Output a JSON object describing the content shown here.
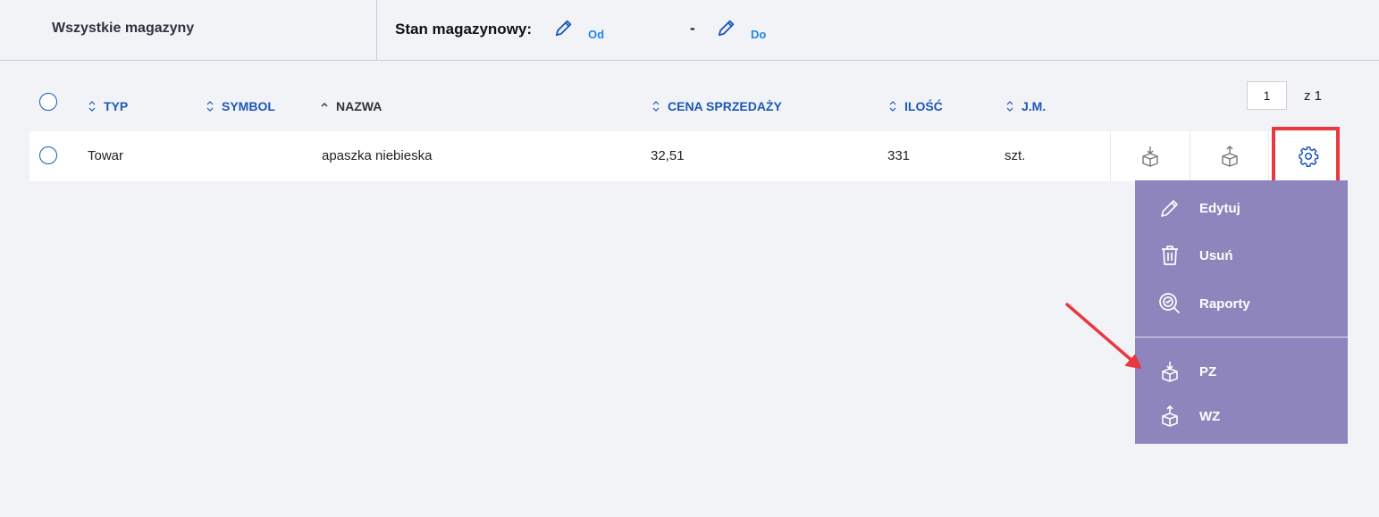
{
  "filters": {
    "warehouse": "Wszystkie magazyny",
    "stock_label": "Stan magazynowy:",
    "from_label": "Od",
    "separator": "-",
    "to_label": "Do"
  },
  "table": {
    "columns": [
      "TYP",
      "SYMBOL",
      "NAZWA",
      "CENA SPRZEDAŻY",
      "ILOŚĆ",
      "J.M."
    ],
    "rows": [
      {
        "typ": "Towar",
        "symbol": "",
        "nazwa": "apaszka niebieska",
        "cena": "32,51",
        "ilosc": "331",
        "jm": "szt."
      }
    ]
  },
  "pager": {
    "page": "1",
    "total": "z 1"
  },
  "menu": {
    "items": [
      {
        "label": "Edytuj",
        "icon": "pencil-icon"
      },
      {
        "label": "Usuń",
        "icon": "trash-icon"
      },
      {
        "label": "Raporty",
        "icon": "report-search-icon"
      },
      {
        "label": "PZ",
        "icon": "box-in-icon"
      },
      {
        "label": "WZ",
        "icon": "box-out-icon"
      }
    ]
  },
  "colors": {
    "accent": "#1c57b8",
    "menu_bg": "#8d85bb",
    "highlight": "#e8393f"
  }
}
